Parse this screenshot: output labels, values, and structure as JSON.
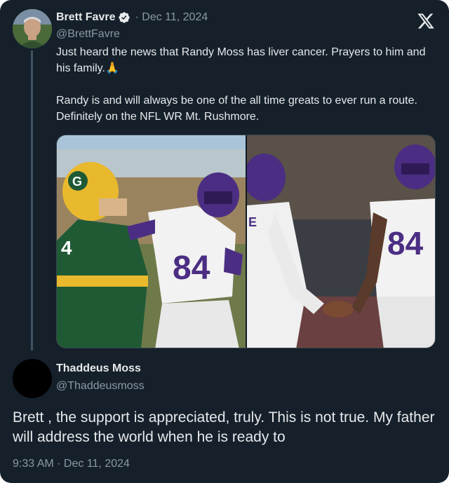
{
  "original_tweet": {
    "author_name": "Brett Favre",
    "date": "· Dec 11, 2024",
    "handle": "@BrettFavre",
    "paragraph_1": "Just heard the news that Randy Moss has liver cancer. Prayers to him and his family.🙏",
    "paragraph_2": "Randy is and will always be one of the all time greats to ever run a route. Definitely on the NFL WR Mt. Rushmore.",
    "media_left_jersey_number": "84",
    "media_right_jersey_number": "84"
  },
  "reply": {
    "author_name": "Thaddeus Moss",
    "handle": "@Thaddeusmoss",
    "text": "Brett , the support is appreciated, truly. This is not true. My father will address the world when he is ready to",
    "timestamp": "9:33 AM · Dec 11, 2024"
  },
  "icons": {
    "verified": "verified-badge-icon",
    "brand": "x-logo-icon"
  },
  "colors": {
    "background": "#15202b",
    "primary_text": "#e7e9ea",
    "secondary_text": "#8b98a5",
    "thread_line": "#425364"
  }
}
